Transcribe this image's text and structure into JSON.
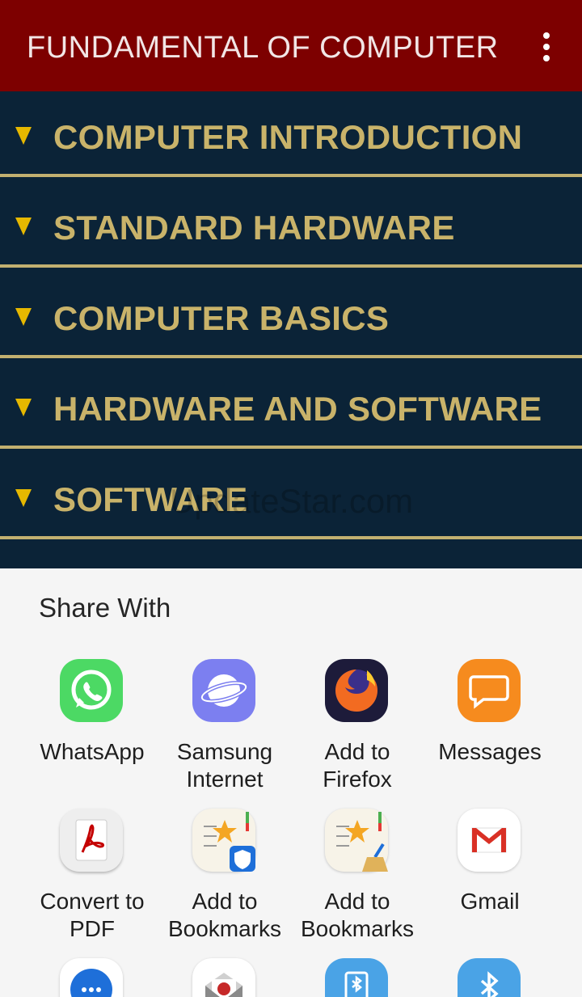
{
  "appbar": {
    "title": "FUNDAMENTAL OF COMPUTER",
    "overflow_icon": "more-vert-icon"
  },
  "topics": [
    {
      "label": "COMPUTER INTRODUCTION"
    },
    {
      "label": "STANDARD HARDWARE"
    },
    {
      "label": "COMPUTER BASICS"
    },
    {
      "label": "HARDWARE AND SOFTWARE"
    },
    {
      "label": "SOFTWARE"
    }
  ],
  "watermark": "UpdateStar.com",
  "share_sheet": {
    "title": "Share With",
    "apps": [
      {
        "label": "WhatsApp",
        "icon": "whatsapp-icon"
      },
      {
        "label": "Samsung Internet",
        "icon": "samsung-internet-icon"
      },
      {
        "label": "Add to Firefox",
        "icon": "firefox-icon"
      },
      {
        "label": "Messages",
        "icon": "messages-icon"
      },
      {
        "label": "Convert to PDF",
        "icon": "pdf-icon"
      },
      {
        "label": "Add to Bookmarks",
        "icon": "bookmarks-shield-icon"
      },
      {
        "label": "Add to Bookmarks",
        "icon": "bookmarks-broom-icon"
      },
      {
        "label": "Gmail",
        "icon": "gmail-icon"
      }
    ]
  },
  "colors": {
    "appbar": "#7d0000",
    "list_background": "#0b2337",
    "topic_text": "#c9b36a",
    "divider": "#c2b070",
    "arrow": "#e6b800"
  }
}
